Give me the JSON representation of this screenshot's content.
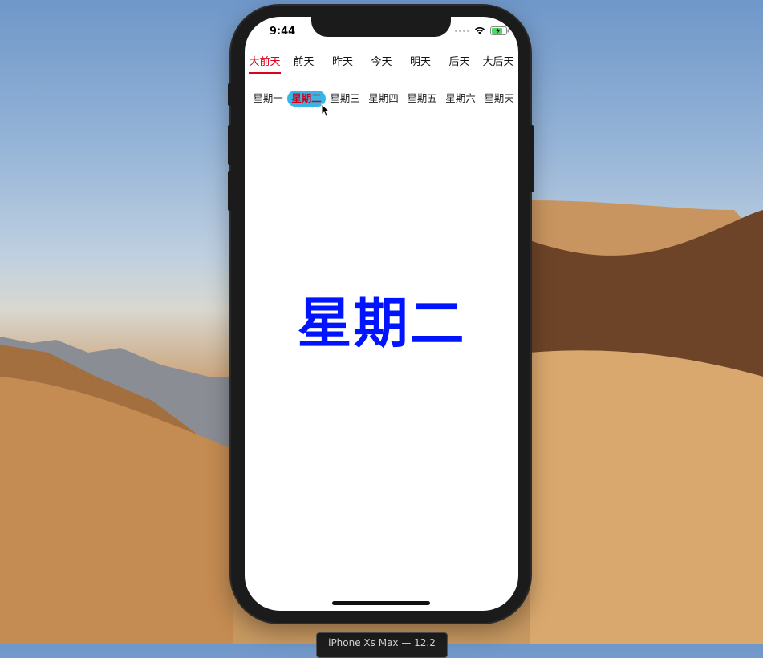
{
  "status_bar": {
    "time": "9:44"
  },
  "top_tabs": [
    {
      "label": "大前天",
      "active": true
    },
    {
      "label": "前天",
      "active": false
    },
    {
      "label": "昨天",
      "active": false
    },
    {
      "label": "今天",
      "active": false
    },
    {
      "label": "明天",
      "active": false
    },
    {
      "label": "后天",
      "active": false
    },
    {
      "label": "大后天",
      "active": false
    }
  ],
  "week_tabs": [
    {
      "label": "星期一",
      "selected": false
    },
    {
      "label": "星期二",
      "selected": true
    },
    {
      "label": "星期三",
      "selected": false
    },
    {
      "label": "星期四",
      "selected": false
    },
    {
      "label": "星期五",
      "selected": false
    },
    {
      "label": "星期六",
      "selected": false
    },
    {
      "label": "星期天",
      "selected": false
    }
  ],
  "content": {
    "title": "星期二"
  },
  "simulator_label": "iPhone Xs Max — 12.2",
  "colors": {
    "active_tab": "#e0001b",
    "selected_pill": "#37b5e5",
    "title_blue": "#0014ff"
  }
}
